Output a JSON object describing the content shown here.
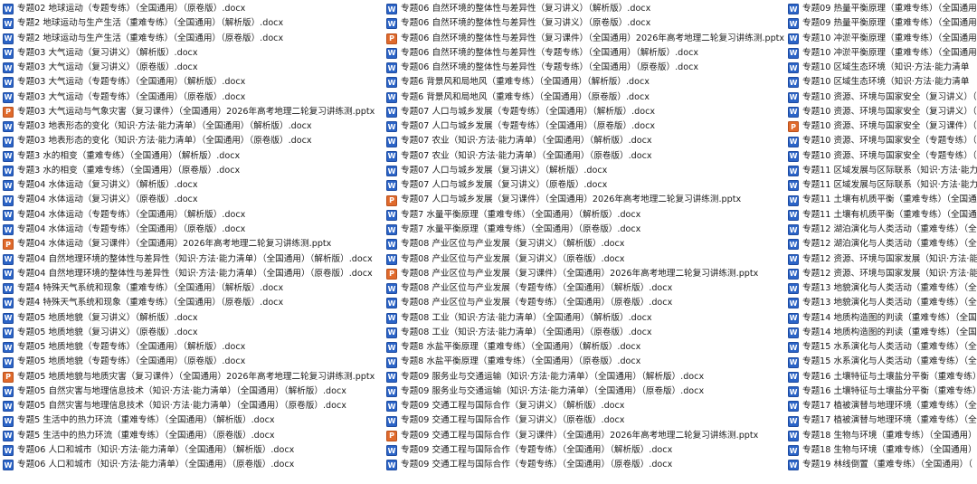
{
  "colors": {
    "docx_icon": "#2b64c7",
    "pptx_icon": "#e06a2c",
    "text": "#1a1a1a",
    "background": "#ffffff"
  },
  "columns": [
    {
      "files": [
        {
          "type": "docx",
          "icon": "word-document-icon",
          "name": "专题02 地球运动（专题专练）（全国通用）（原卷版）.docx"
        },
        {
          "type": "docx",
          "icon": "word-document-icon",
          "name": "专题2 地球运动与生产生活（重难专练）（全国通用）（解析版）.docx"
        },
        {
          "type": "docx",
          "icon": "word-document-icon",
          "name": "专题2 地球运动与生产生活（重难专练）（全国通用）（原卷版）.docx"
        },
        {
          "type": "docx",
          "icon": "word-document-icon",
          "name": "专题03 大气运动（复习讲义）（解析版）.docx"
        },
        {
          "type": "docx",
          "icon": "word-document-icon",
          "name": "专题03 大气运动（复习讲义）（原卷版）.docx"
        },
        {
          "type": "docx",
          "icon": "word-document-icon",
          "name": "专题03 大气运动（专题专练）（全国通用）（解析版）.docx"
        },
        {
          "type": "docx",
          "icon": "word-document-icon",
          "name": "专题03 大气运动（专题专练）（全国通用）（原卷版）.docx"
        },
        {
          "type": "pptx",
          "icon": "powerpoint-document-icon",
          "name": "专题03 大气运动与气象灾害（复习课件）（全国通用）2026年高考地理二轮复习讲练测.pptx"
        },
        {
          "type": "docx",
          "icon": "word-document-icon",
          "name": "专题03 地表形态的变化（知识·方法·能力清单）（全国通用）（解析版）.docx"
        },
        {
          "type": "docx",
          "icon": "word-document-icon",
          "name": "专题03 地表形态的变化（知识·方法·能力清单）（全国通用）（原卷版）.docx"
        },
        {
          "type": "docx",
          "icon": "word-document-icon",
          "name": "专题3 水的相变（重难专练）（全国通用）（解析版）.docx"
        },
        {
          "type": "docx",
          "icon": "word-document-icon",
          "name": "专题3 水的相变（重难专练）（全国通用）（原卷版）.docx"
        },
        {
          "type": "docx",
          "icon": "word-document-icon",
          "name": "专题04 水体运动（复习讲义）（解析版）.docx"
        },
        {
          "type": "docx",
          "icon": "word-document-icon",
          "name": "专题04 水体运动（复习讲义）（原卷版）.docx"
        },
        {
          "type": "docx",
          "icon": "word-document-icon",
          "name": "专题04 水体运动（专题专练）（全国通用）（解析版）.docx"
        },
        {
          "type": "docx",
          "icon": "word-document-icon",
          "name": "专题04 水体运动（专题专练）（全国通用）（原卷版）.docx"
        },
        {
          "type": "pptx",
          "icon": "powerpoint-document-icon",
          "name": "专题04 水体运动（复习课件）（全国通用）2026年高考地理二轮复习讲练测.pptx"
        },
        {
          "type": "docx",
          "icon": "word-document-icon",
          "name": "专题04 自然地理环境的整体性与差异性（知识·方法·能力清单）（全国通用）（解析版）.docx"
        },
        {
          "type": "docx",
          "icon": "word-document-icon",
          "name": "专题04 自然地理环境的整体性与差异性（知识·方法·能力清单）（全国通用）（原卷版）.docx"
        },
        {
          "type": "docx",
          "icon": "word-document-icon",
          "name": "专题4 特殊天气系统和现象（重难专练）（全国通用）（解析版）.docx"
        },
        {
          "type": "docx",
          "icon": "word-document-icon",
          "name": "专题4 特殊天气系统和现象（重难专练）（全国通用）（原卷版）.docx"
        },
        {
          "type": "docx",
          "icon": "word-document-icon",
          "name": "专题05 地质地貌（复习讲义）（解析版）.docx"
        },
        {
          "type": "docx",
          "icon": "word-document-icon",
          "name": "专题05 地质地貌（复习讲义）（原卷版）.docx"
        },
        {
          "type": "docx",
          "icon": "word-document-icon",
          "name": "专题05 地质地貌（专题专练）（全国通用）（解析版）.docx"
        },
        {
          "type": "docx",
          "icon": "word-document-icon",
          "name": "专题05 地质地貌（专题专练）（全国通用）（原卷版）.docx"
        },
        {
          "type": "pptx",
          "icon": "powerpoint-document-icon",
          "name": "专题05 地质地貌与地质灾害（复习课件）（全国通用）2026年高考地理二轮复习讲练测.pptx"
        },
        {
          "type": "docx",
          "icon": "word-document-icon",
          "name": "专题05 自然灾害与地理信息技术（知识·方法·能力清单）（全国通用）（解析版）.docx"
        },
        {
          "type": "docx",
          "icon": "word-document-icon",
          "name": "专题05 自然灾害与地理信息技术（知识·方法·能力清单）（全国通用）（原卷版）.docx"
        },
        {
          "type": "docx",
          "icon": "word-document-icon",
          "name": "专题5 生活中的热力环流（重难专练）（全国通用）（解析版）.docx"
        },
        {
          "type": "docx",
          "icon": "word-document-icon",
          "name": "专题5 生活中的热力环流（重难专练）（全国通用）（原卷版）.docx"
        },
        {
          "type": "docx",
          "icon": "word-document-icon",
          "name": "专题06 人口和城市（知识·方法·能力清单）（全国通用）（解析版）.docx"
        },
        {
          "type": "docx",
          "icon": "word-document-icon",
          "name": "专题06 人口和城市（知识·方法·能力清单）（全国通用）（原卷版）.docx"
        }
      ]
    },
    {
      "files": [
        {
          "type": "docx",
          "icon": "word-document-icon",
          "name": "专题06 自然环境的整体性与差异性（复习讲义）（解析版）.docx"
        },
        {
          "type": "docx",
          "icon": "word-document-icon",
          "name": "专题06 自然环境的整体性与差异性（复习讲义）（原卷版）.docx"
        },
        {
          "type": "pptx",
          "icon": "powerpoint-document-icon",
          "name": "专题06 自然环境的整体性与差异性（复习课件）（全国通用）2026年高考地理二轮复习讲练测.pptx"
        },
        {
          "type": "docx",
          "icon": "word-document-icon",
          "name": "专题06 自然环境的整体性与差异性（专题专练）（全国通用）（解析版）.docx"
        },
        {
          "type": "docx",
          "icon": "word-document-icon",
          "name": "专题06 自然环境的整体性与差异性（专题专练）（全国通用）（原卷版）.docx"
        },
        {
          "type": "docx",
          "icon": "word-document-icon",
          "name": "专题6 背景风和局地风（重难专练）（全国通用）（解析版）.docx"
        },
        {
          "type": "docx",
          "icon": "word-document-icon",
          "name": "专题6 背景风和局地风（重难专练）（全国通用）（原卷版）.docx"
        },
        {
          "type": "docx",
          "icon": "word-document-icon",
          "name": "专题07 人口与城乡发展（专题专练）（全国通用）（解析版）.docx"
        },
        {
          "type": "docx",
          "icon": "word-document-icon",
          "name": "专题07 人口与城乡发展（专题专练）（全国通用）（原卷版）.docx"
        },
        {
          "type": "docx",
          "icon": "word-document-icon",
          "name": "专题07 农业（知识·方法·能力清单）（全国通用）（解析版）.docx"
        },
        {
          "type": "docx",
          "icon": "word-document-icon",
          "name": "专题07 农业（知识·方法·能力清单）（全国通用）（原卷版）.docx"
        },
        {
          "type": "docx",
          "icon": "word-document-icon",
          "name": "专题07 人口与城乡发展（复习讲义）（解析版）.docx"
        },
        {
          "type": "docx",
          "icon": "word-document-icon",
          "name": "专题07 人口与城乡发展（复习讲义）（原卷版）.docx"
        },
        {
          "type": "pptx",
          "icon": "powerpoint-document-icon",
          "name": "专题07 人口与城乡发展（复习课件）（全国通用）2026年高考地理二轮复习讲练测.pptx"
        },
        {
          "type": "docx",
          "icon": "word-document-icon",
          "name": "专题7 水量平衡原理（重难专练）（全国通用）（解析版）.docx"
        },
        {
          "type": "docx",
          "icon": "word-document-icon",
          "name": "专题7 水量平衡原理（重难专练）（全国通用）（原卷版）.docx"
        },
        {
          "type": "docx",
          "icon": "word-document-icon",
          "name": "专题08 产业区位与产业发展（复习讲义）（解析版）.docx"
        },
        {
          "type": "docx",
          "icon": "word-document-icon",
          "name": "专题08 产业区位与产业发展（复习讲义）（原卷版）.docx"
        },
        {
          "type": "pptx",
          "icon": "powerpoint-document-icon",
          "name": "专题08 产业区位与产业发展（复习课件）（全国通用）2026年高考地理二轮复习讲练测.pptx"
        },
        {
          "type": "docx",
          "icon": "word-document-icon",
          "name": "专题08 产业区位与产业发展（专题专练）（全国通用）（解析版）.docx"
        },
        {
          "type": "docx",
          "icon": "word-document-icon",
          "name": "专题08 产业区位与产业发展（专题专练）（全国通用）（原卷版）.docx"
        },
        {
          "type": "docx",
          "icon": "word-document-icon",
          "name": "专题08 工业（知识·方法·能力清单）（全国通用）（解析版）.docx"
        },
        {
          "type": "docx",
          "icon": "word-document-icon",
          "name": "专题08 工业（知识·方法·能力清单）（全国通用）（原卷版）.docx"
        },
        {
          "type": "docx",
          "icon": "word-document-icon",
          "name": "专题8 水盐平衡原理（重难专练）（全国通用）（解析版）.docx"
        },
        {
          "type": "docx",
          "icon": "word-document-icon",
          "name": "专题8 水盐平衡原理（重难专练）（全国通用）（原卷版）.docx"
        },
        {
          "type": "docx",
          "icon": "word-document-icon",
          "name": "专题09 服务业与交通运输（知识·方法·能力清单）（全国通用）（解析版）.docx"
        },
        {
          "type": "docx",
          "icon": "word-document-icon",
          "name": "专题09 服务业与交通运输（知识·方法·能力清单）（全国通用）（原卷版）.docx"
        },
        {
          "type": "docx",
          "icon": "word-document-icon",
          "name": "专题09 交通工程与国际合作（复习讲义）（解析版）.docx"
        },
        {
          "type": "docx",
          "icon": "word-document-icon",
          "name": "专题09 交通工程与国际合作（复习讲义）（原卷版）.docx"
        },
        {
          "type": "pptx",
          "icon": "powerpoint-document-icon",
          "name": "专题09 交通工程与国际合作（复习课件）（全国通用）2026年高考地理二轮复习讲练测.pptx"
        },
        {
          "type": "docx",
          "icon": "word-document-icon",
          "name": "专题09 交通工程与国际合作（专题专练）（全国通用）（解析版）.docx"
        },
        {
          "type": "docx",
          "icon": "word-document-icon",
          "name": "专题09 交通工程与国际合作（专题专练）（全国通用）（原卷版）.docx"
        }
      ]
    },
    {
      "files": [
        {
          "type": "docx",
          "icon": "word-document-icon",
          "name": "专题09 热量平衡原理（重难专练）（全国通用"
        },
        {
          "type": "docx",
          "icon": "word-document-icon",
          "name": "专题09 热量平衡原理（重难专练）（全国通用"
        },
        {
          "type": "docx",
          "icon": "word-document-icon",
          "name": "专题10 冲淤平衡原理（重难专练）（全国通用"
        },
        {
          "type": "docx",
          "icon": "word-document-icon",
          "name": "专题10 冲淤平衡原理（重难专练）（全国通用"
        },
        {
          "type": "docx",
          "icon": "word-document-icon",
          "name": "专题10 区域生态环境（知识·方法·能力清单"
        },
        {
          "type": "docx",
          "icon": "word-document-icon",
          "name": "专题10 区域生态环境（知识·方法·能力清单"
        },
        {
          "type": "docx",
          "icon": "word-document-icon",
          "name": "专题10 资源、环境与国家安全（复习讲义）（"
        },
        {
          "type": "docx",
          "icon": "word-document-icon",
          "name": "专题10 资源、环境与国家安全（复习讲义）（"
        },
        {
          "type": "pptx",
          "icon": "powerpoint-document-icon",
          "name": "专题10 资源、环境与国家安全（复习课件）（"
        },
        {
          "type": "docx",
          "icon": "word-document-icon",
          "name": "专题10 资源、环境与国家安全（专题专练）（"
        },
        {
          "type": "docx",
          "icon": "word-document-icon",
          "name": "专题10 资源、环境与国家安全（专题专练）（"
        },
        {
          "type": "docx",
          "icon": "word-document-icon",
          "name": "专题11 区域发展与区际联系（知识·方法·能力"
        },
        {
          "type": "docx",
          "icon": "word-document-icon",
          "name": "专题11 区域发展与区际联系（知识·方法·能力"
        },
        {
          "type": "docx",
          "icon": "word-document-icon",
          "name": "专题11 土壤有机质平衡（重难专练）（全国通"
        },
        {
          "type": "docx",
          "icon": "word-document-icon",
          "name": "专题11 土壤有机质平衡（重难专练）（全国通"
        },
        {
          "type": "docx",
          "icon": "word-document-icon",
          "name": "专题12 湖泊演化与人类活动（重难专练）（全"
        },
        {
          "type": "docx",
          "icon": "word-document-icon",
          "name": "专题12 湖泊演化与人类活动（重难专练）（全"
        },
        {
          "type": "docx",
          "icon": "word-document-icon",
          "name": "专题12 资源、环境与国家发展（知识·方法·能力"
        },
        {
          "type": "docx",
          "icon": "word-document-icon",
          "name": "专题12 资源、环境与国家发展（知识·方法·能力"
        },
        {
          "type": "docx",
          "icon": "word-document-icon",
          "name": "专题13 地貌演化与人类活动（重难专练）（全"
        },
        {
          "type": "docx",
          "icon": "word-document-icon",
          "name": "专题13 地貌演化与人类活动（重难专练）（全"
        },
        {
          "type": "docx",
          "icon": "word-document-icon",
          "name": "专题14 地质构造图的判读（重难专练）（全国"
        },
        {
          "type": "docx",
          "icon": "word-document-icon",
          "name": "专题14 地质构造图的判读（重难专练）（全国"
        },
        {
          "type": "docx",
          "icon": "word-document-icon",
          "name": "专题15 水系演化与人类活动（重难专练）（全"
        },
        {
          "type": "docx",
          "icon": "word-document-icon",
          "name": "专题15 水系演化与人类活动（重难专练）（全"
        },
        {
          "type": "docx",
          "icon": "word-document-icon",
          "name": "专题16 土壤特征与土壤盐分平衡（重难专练）"
        },
        {
          "type": "docx",
          "icon": "word-document-icon",
          "name": "专题16 土壤特征与土壤盐分平衡（重难专练）"
        },
        {
          "type": "docx",
          "icon": "word-document-icon",
          "name": "专题17 植被演替与地理环境（重难专练）（全"
        },
        {
          "type": "docx",
          "icon": "word-document-icon",
          "name": "专题17 植被演替与地理环境（重难专练）（全"
        },
        {
          "type": "docx",
          "icon": "word-document-icon",
          "name": "专题18 生物与环境（重难专练）（全国通用）"
        },
        {
          "type": "docx",
          "icon": "word-document-icon",
          "name": "专题18 生物与环境（重难专练）（全国通用）"
        },
        {
          "type": "docx",
          "icon": "word-document-icon",
          "name": "专题19 林线倒置（重难专练）（全国通用）（"
        }
      ]
    }
  ]
}
